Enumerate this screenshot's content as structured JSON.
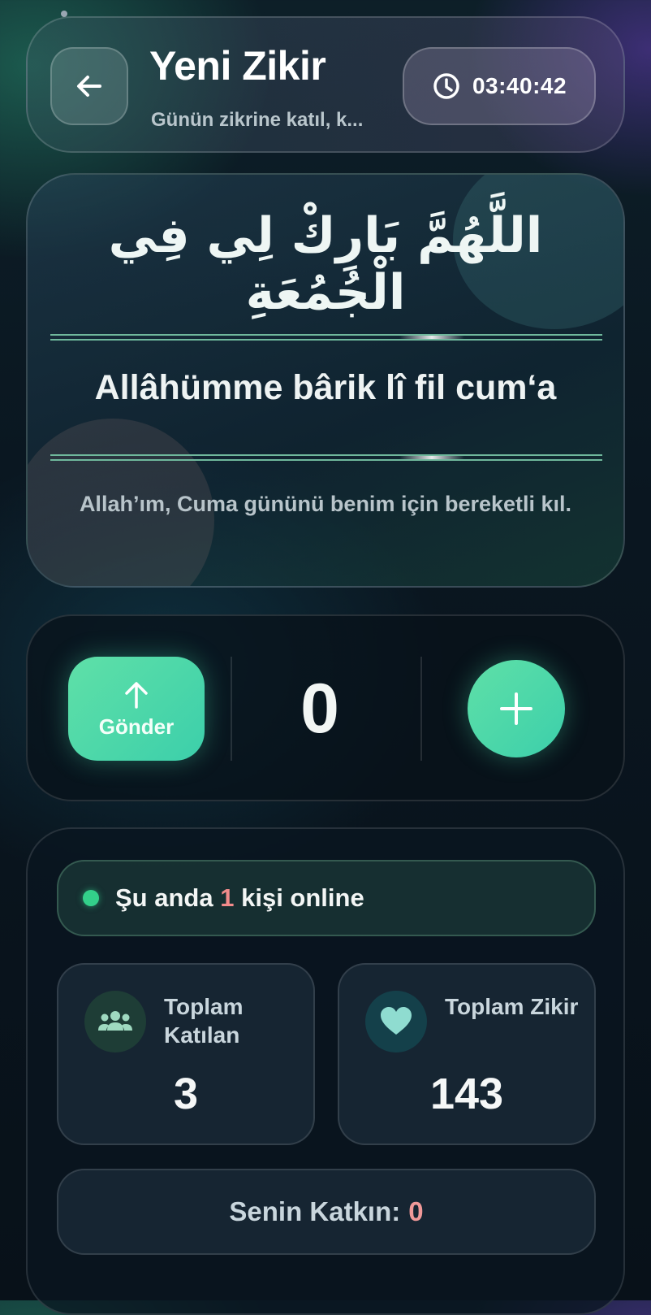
{
  "header": {
    "title": "Yeni Zikir",
    "subtitle": "Günün zikrine katıl, k...",
    "timer": "03:40:42"
  },
  "dua": {
    "arabic": "اللَّهُمَّ بَارِكْ لِي فِي الْجُمُعَةِ",
    "transliteration": "Allâhümme bârik lî fil cum‘a",
    "meaning": "Allah’ım, Cuma gününü benim için bereketli kıl."
  },
  "counter": {
    "send_label": "Gönder",
    "count": "0"
  },
  "stats": {
    "online_prefix": "Şu anda",
    "online_count": "1",
    "online_suffix": "kişi online",
    "total_participants_label": "Toplam Katılan",
    "total_participants_value": "3",
    "total_zikir_label": "Toplam Zikir",
    "total_zikir_value": "143",
    "contribution_label": "Senin Katkın:",
    "contribution_value": "0"
  },
  "icons": {
    "back": "arrow-left-icon",
    "timer": "clock-icon",
    "send": "arrow-up-icon",
    "add": "plus-icon",
    "online": "green-dot",
    "participants": "users-icon",
    "zikir": "heart-icon"
  },
  "colors": {
    "accent": "#4cd9a8",
    "highlight": "#f28b8b",
    "online": "#33d08a"
  }
}
